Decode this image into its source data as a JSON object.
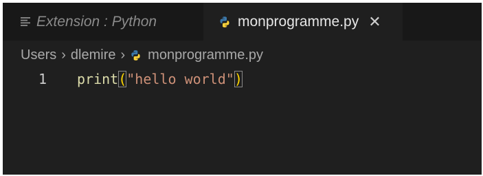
{
  "tabs": [
    {
      "label": "Extension : Python",
      "icon": "preview-lines-icon",
      "active": false
    },
    {
      "label": "monprogramme.py",
      "icon": "python-icon",
      "active": true,
      "close_glyph": "✕"
    }
  ],
  "breadcrumb": {
    "items": [
      "Users",
      "dlemire",
      "monprogramme.py"
    ],
    "separator": "›"
  },
  "editor": {
    "lines": [
      {
        "number": "1",
        "tokens": {
          "fn": "print",
          "open_paren": "(",
          "string": "\"hello world\"",
          "close_paren": ")"
        }
      }
    ]
  },
  "colors": {
    "background": "#1f1f1f",
    "tabbar": "#181818",
    "function": "#dcdcaa",
    "string": "#ce9178",
    "bracket": "#ffd700",
    "python_blue": "#3c78aa",
    "python_yellow": "#ffd43b"
  }
}
